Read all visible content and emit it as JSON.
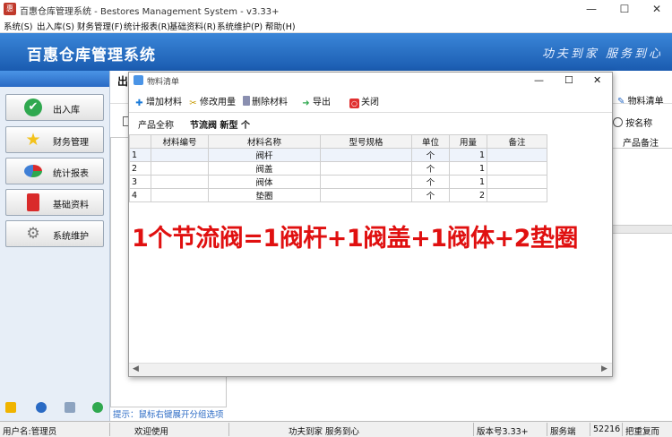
{
  "window": {
    "title": "百惠仓库管理系统 - Bestores Management System - v3.33+",
    "controls": {
      "minimize": "—",
      "maximize": "☐",
      "close": "✕"
    }
  },
  "menu": [
    "系统(S)",
    "出入库(S)",
    "财务管理(F)",
    "统计报表(R)",
    "基础资料(R)",
    "系统维护(P)",
    "帮助(H)"
  ],
  "banner": {
    "title": "百惠仓库管理系统",
    "slogan": "功夫到家 服务到心"
  },
  "sidebar": {
    "items": [
      {
        "label": "出入库",
        "icon": "check-icon",
        "color": "#2fa84f"
      },
      {
        "label": "财务管理",
        "icon": "star-icon",
        "color": "#f3c21b"
      },
      {
        "label": "统计报表",
        "icon": "pie-chart-icon",
        "color": "#3f7fd6"
      },
      {
        "label": "基础资料",
        "icon": "book-icon",
        "color": "#d92b2b"
      },
      {
        "label": "系统维护",
        "icon": "gear-icon",
        "color": "#777777"
      }
    ]
  },
  "background": {
    "tab_label": "出",
    "right_toolbar_label": "物料清单",
    "radio_label": "按名称",
    "column_header": "产品备注",
    "hint": "提示：鼠标右键展开分组选项"
  },
  "dialog": {
    "title": "物料清单",
    "controls": {
      "minimize": "—",
      "maximize": "☐",
      "close": "✕"
    },
    "toolbar": {
      "add": "增加材料",
      "modify": "修改用量",
      "delete": "删除材料",
      "export": "导出",
      "close": "关闭"
    },
    "product_label": "产品全称",
    "product_value": "节流阀 新型 个",
    "columns": [
      "",
      "材料编号",
      "材料名称",
      "型号规格",
      "单位",
      "用量",
      "备注"
    ],
    "rows": [
      [
        "1",
        "",
        "阀杆",
        "",
        "个",
        "1",
        ""
      ],
      [
        "2",
        "",
        "阀盖",
        "",
        "个",
        "1",
        ""
      ],
      [
        "3",
        "",
        "阀体",
        "",
        "个",
        "1",
        ""
      ],
      [
        "4",
        "",
        "垫圈",
        "",
        "个",
        "2",
        ""
      ]
    ]
  },
  "overlay_text": "1个节流阀=1阀杆+1阀盖+1阀体+2垫圈",
  "status": {
    "user": "用户名:管理员",
    "welcome": "欢迎使用",
    "slogan": "功夫到家 服务到心",
    "version": "版本号3.33+",
    "server": "服务端",
    "port": "52216",
    "extra": "把重复而"
  }
}
